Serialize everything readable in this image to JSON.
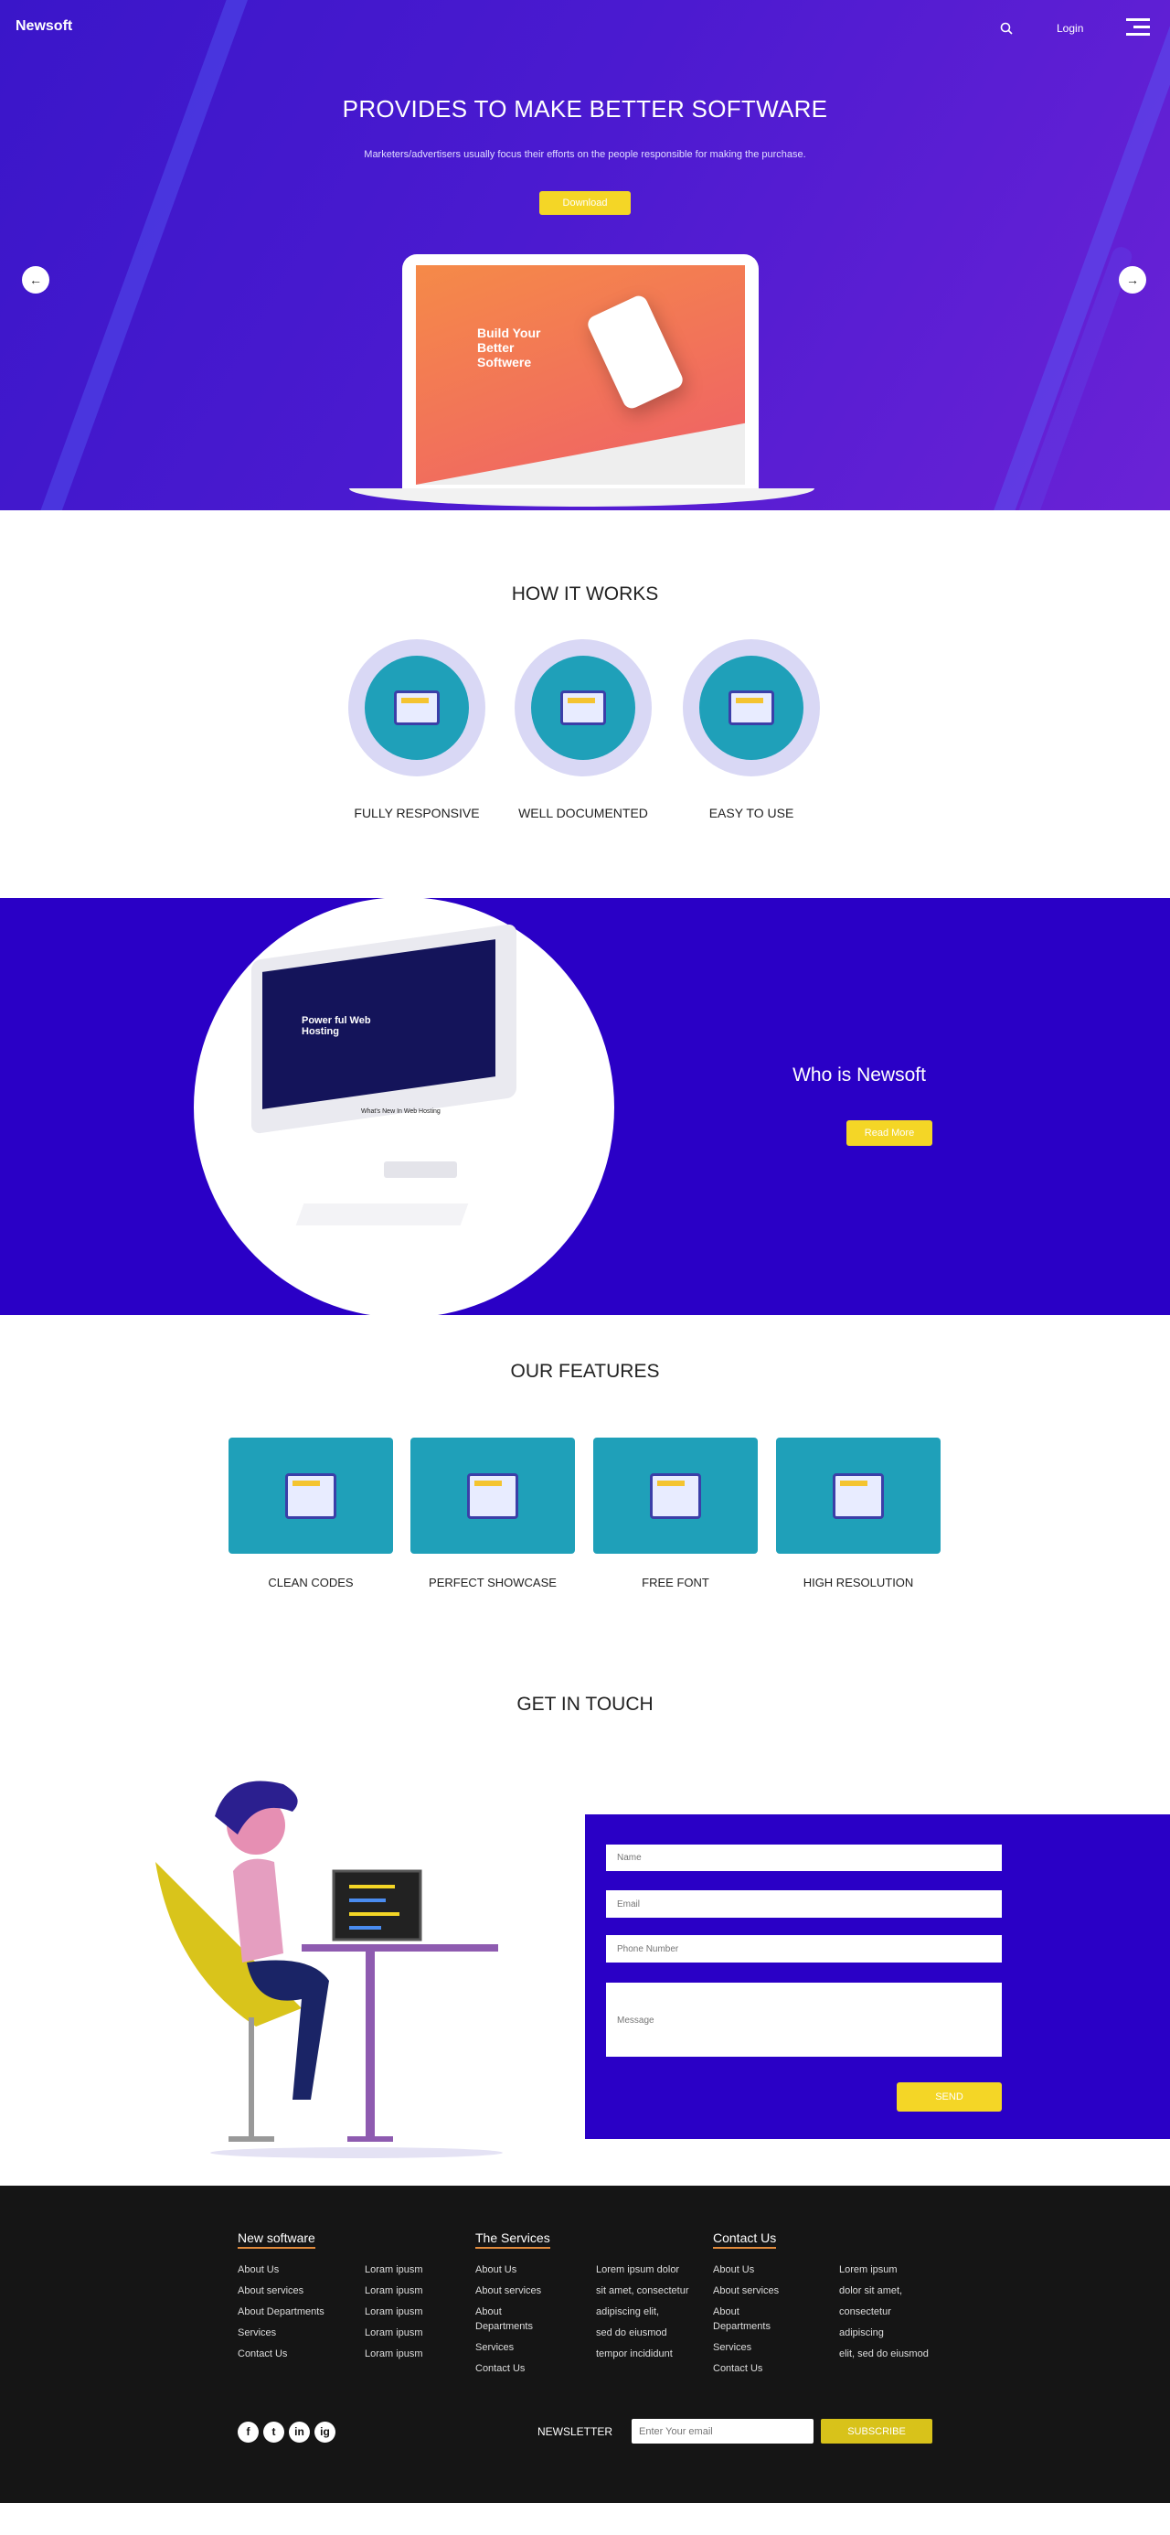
{
  "header": {
    "logo": "Newsoft",
    "login": "Login",
    "search_icon": "search-icon",
    "menu_icon": "hamburger-icon"
  },
  "hero": {
    "title": "PROVIDES TO MAKE BETTER SOFTWARE",
    "subtitle": "Marketers/advertisers usually focus their efforts on the people responsible for making the purchase.",
    "button": "Download",
    "mockup_headline": "Build Your Better Softwere",
    "prev_icon": "arrow-left-icon",
    "next_icon": "arrow-right-icon"
  },
  "how": {
    "title": "HOW IT WORKS",
    "items": [
      {
        "label": "FULLY RESPONSIVE"
      },
      {
        "label": "WELL DOCUMENTED"
      },
      {
        "label": "EASY TO USE"
      }
    ]
  },
  "about": {
    "title": "Who is Newsoft",
    "button": "Read More",
    "mockup_headline": "Power ful Web Hosting",
    "mockup_caption": "What's New In Web Hosting"
  },
  "features": {
    "title": "OUR FEATURES",
    "items": [
      {
        "label": "CLEAN CODES"
      },
      {
        "label": "PERFECT SHOWCASE"
      },
      {
        "label": "FREE FONT"
      },
      {
        "label": "HIGH RESOLUTION"
      }
    ]
  },
  "contact": {
    "title": "GET IN TOUCH",
    "name": "Name",
    "email": "Email",
    "phone": "Phone Number",
    "message": "Message",
    "send": "SEND"
  },
  "footer": {
    "cols": [
      {
        "title": "New software",
        "a": [
          "About Us",
          "About services",
          "About Departments",
          "Services",
          "Contact Us"
        ],
        "b": [
          "Loram ipusm",
          "Loram ipusm",
          "Loram ipusm",
          "Loram ipusm",
          "Loram ipusm"
        ]
      },
      {
        "title": "The Services",
        "a": [
          "About Us",
          "About services",
          "About Departments",
          "Services",
          "Contact Us"
        ],
        "b": [
          "Lorem ipsum dolor",
          "sit amet, consectetur",
          "adipiscing elit,",
          "sed do eiusmod",
          "tempor incididunt"
        ]
      },
      {
        "title": "Contact Us",
        "a": [
          "About Us",
          "About services",
          "About Departments",
          "Services",
          "Contact Us"
        ],
        "b": [
          "Lorem ipsum",
          "dolor sit amet,",
          "consectetur",
          "adipiscing",
          "elit, sed do eiusmod"
        ]
      }
    ],
    "social": [
      "f",
      "t",
      "in",
      "ig"
    ],
    "newsletter": "NEWSLETTER",
    "email_placeholder": "Enter Your email",
    "subscribe": "SUBSCRIBE"
  },
  "colors": {
    "hero": "#3a16c9",
    "accent_yellow": "#f4d626",
    "teal": "#1fa0b9",
    "section_blue": "#2a00c6",
    "footer": "#151515"
  }
}
